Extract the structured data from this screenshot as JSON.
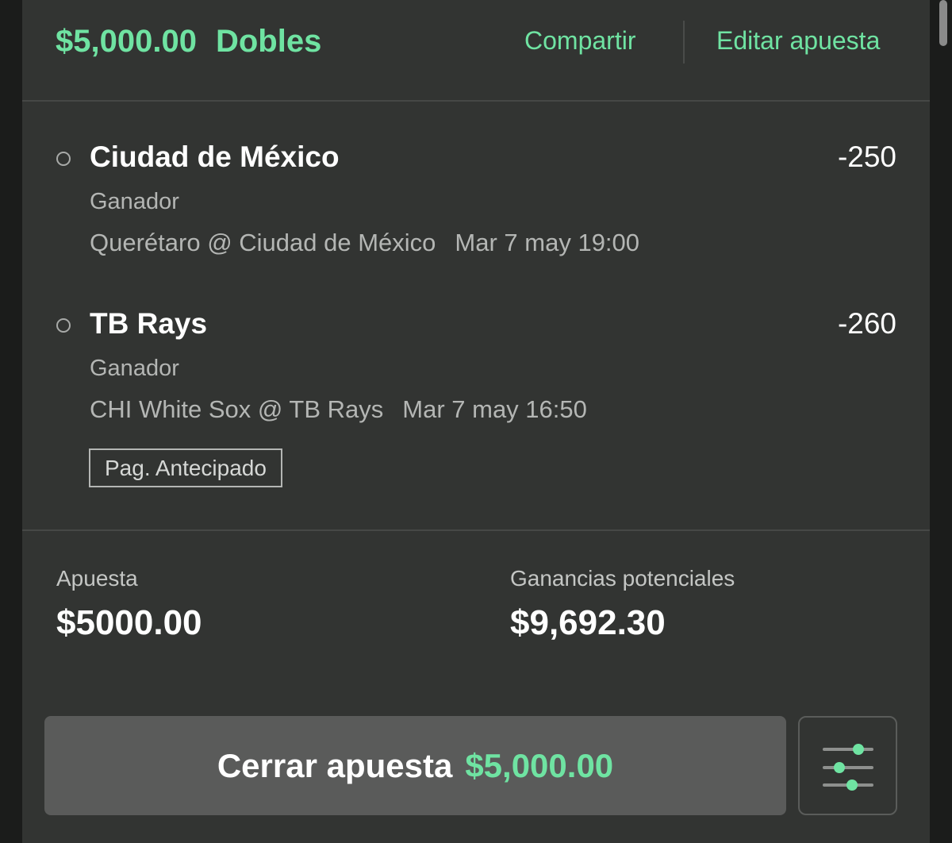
{
  "header": {
    "amount": "$5,000.00",
    "bet_type": "Dobles",
    "share_label": "Compartir",
    "edit_label": "Editar apuesta"
  },
  "legs": [
    {
      "selection": "Ciudad de México",
      "odds": "-250",
      "market": "Ganador",
      "event": "Querétaro @ Ciudad de México",
      "datetime": "Mar 7 may 19:00"
    },
    {
      "selection": "TB Rays",
      "odds": "-260",
      "market": "Ganador",
      "event": "CHI White Sox @ TB Rays",
      "datetime": "Mar 7 may 16:50",
      "tag": "Pag. Antecipado"
    }
  ],
  "summary": {
    "stake_label": "Apuesta",
    "stake_value": "$5000.00",
    "winnings_label": "Ganancias potenciales",
    "winnings_value": "$9,692.30"
  },
  "actions": {
    "cashout_label": "Cerrar apuesta",
    "cashout_amount": "$5,000.00",
    "settings_icon": "sliders-icon"
  },
  "colors": {
    "accent": "#6fe3a2",
    "card_bg": "#323432",
    "page_bg": "#1b1c1b",
    "button_bg": "#5a5b5a"
  }
}
